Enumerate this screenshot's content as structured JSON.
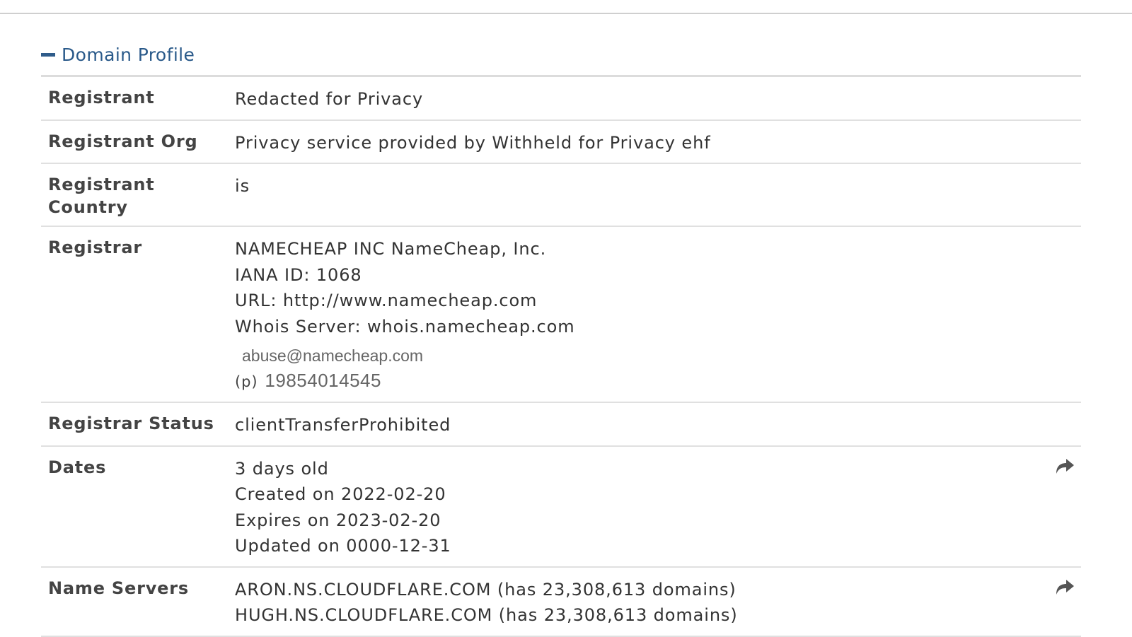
{
  "profile": {
    "title": "Domain Profile",
    "rows": {
      "registrant": {
        "label": "Registrant",
        "value": "Redacted for Privacy"
      },
      "registrant_org": {
        "label": "Registrant Org",
        "value": "Privacy service provided by Withheld for Privacy ehf"
      },
      "registrant_country": {
        "label": "Registrant Country",
        "value": "is"
      },
      "registrar": {
        "label": "Registrar",
        "name": "NAMECHEAP INC NameCheap, Inc.",
        "iana": "IANA ID: 1068",
        "url": "URL: http://www.namecheap.com",
        "whois_server": "Whois Server: whois.namecheap.com",
        "abuse_email": "abuse@namecheap.com",
        "phone_prefix": "(p)",
        "phone": "19854014545"
      },
      "registrar_status": {
        "label": "Registrar Status",
        "value": "clientTransferProhibited"
      },
      "dates": {
        "label": "Dates",
        "age": "3 days old",
        "created": "Created on 2022-02-20",
        "expires": "Expires on 2023-02-20",
        "updated": "Updated on 0000-12-31"
      },
      "name_servers": {
        "label": "Name Servers",
        "servers": [
          "ARON.NS.CLOUDFLARE.COM (has 23,308,613 domains)",
          "HUGH.NS.CLOUDFLARE.COM (has 23,308,613 domains)"
        ]
      }
    }
  },
  "icons": {
    "collapse": "minus-icon",
    "share": "share-arrow-icon"
  },
  "colors": {
    "title": "#2a5a8a",
    "label": "#444444",
    "value": "#333333",
    "divider": "#e0e0e0",
    "icon": "#555555"
  }
}
